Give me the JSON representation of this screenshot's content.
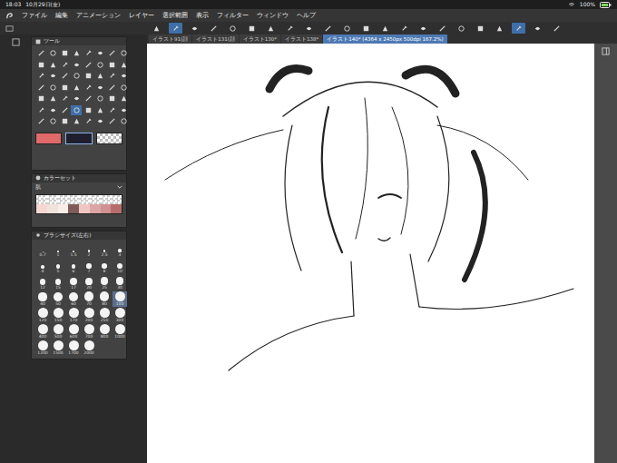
{
  "status_bar": {
    "time": "18:03",
    "date": "10月29日(金)",
    "battery": "100%"
  },
  "menu": [
    "ファイル",
    "編集",
    "アニメーション",
    "レイヤー",
    "選択範囲",
    "表示",
    "フィルター",
    "ウィンドウ",
    "ヘルプ"
  ],
  "commands": [
    {
      "selected": false
    },
    {
      "selected": true
    },
    {
      "selected": false
    },
    {
      "selected": false
    },
    {
      "selected": false
    },
    {
      "selected": false
    },
    {
      "selected": false
    },
    {
      "selected": false
    },
    {
      "selected": false
    },
    {
      "selected": false
    },
    {
      "selected": false
    },
    {
      "selected": false
    },
    {
      "selected": false
    },
    {
      "selected": false
    },
    {
      "selected": false
    },
    {
      "selected": false
    },
    {
      "selected": false
    },
    {
      "selected": false
    },
    {
      "selected": false
    },
    {
      "selected": true
    },
    {
      "selected": false
    },
    {
      "selected": false
    }
  ],
  "tabs": [
    {
      "label": "イラスト91(顔",
      "selected": false
    },
    {
      "label": "イラスト131(顔",
      "selected": false
    },
    {
      "label": "イラスト130*",
      "selected": false
    },
    {
      "label": "イラスト138*",
      "selected": false
    },
    {
      "label": "イラスト140* (4364 x 2450px 500dpi 167.2%)",
      "selected": true
    }
  ],
  "tool_panel": {
    "title": "ツール",
    "tools": [
      {
        "selected": false
      },
      {
        "selected": false
      },
      {
        "selected": false
      },
      {
        "selected": false
      },
      {
        "selected": false
      },
      {
        "selected": false
      },
      {
        "selected": false
      },
      {
        "selected": false
      },
      {
        "selected": false
      },
      {
        "selected": false
      },
      {
        "selected": false
      },
      {
        "selected": false
      },
      {
        "selected": false
      },
      {
        "selected": false
      },
      {
        "selected": false
      },
      {
        "selected": false
      },
      {
        "selected": false
      },
      {
        "selected": false
      },
      {
        "selected": false
      },
      {
        "selected": false
      },
      {
        "selected": false
      },
      {
        "selected": false
      },
      {
        "selected": false
      },
      {
        "selected": false
      },
      {
        "selected": false
      },
      {
        "selected": false
      },
      {
        "selected": false
      },
      {
        "selected": false
      },
      {
        "selected": false
      },
      {
        "selected": false
      },
      {
        "selected": false
      },
      {
        "selected": false
      },
      {
        "selected": false
      },
      {
        "selected": false
      },
      {
        "selected": false
      },
      {
        "selected": false
      },
      {
        "selected": false
      },
      {
        "selected": false
      },
      {
        "selected": false
      },
      {
        "selected": false
      },
      {
        "selected": false
      },
      {
        "selected": false
      },
      {
        "selected": false
      },
      {
        "selected": true
      },
      {
        "selected": false
      },
      {
        "selected": false
      },
      {
        "selected": false
      },
      {
        "selected": false
      },
      {
        "selected": false
      },
      {
        "selected": false
      },
      {
        "selected": false
      },
      {
        "selected": false
      },
      {
        "selected": false
      },
      {
        "selected": false
      },
      {
        "selected": false
      },
      {
        "selected": false
      }
    ],
    "colors": [
      {
        "kind": "solid",
        "color": "#e06a6a",
        "selected": false
      },
      {
        "kind": "solid",
        "color": "#1e1e2c",
        "selected": true
      },
      {
        "kind": "transparent",
        "color": "#ffffff",
        "selected": false
      }
    ]
  },
  "color_set": {
    "title": "カラーセット",
    "set_name": "肌",
    "swatches": [
      {
        "kind": "transparent",
        "color": "#ffffff"
      },
      {
        "kind": "transparent",
        "color": "#ffffff"
      },
      {
        "kind": "transparent",
        "color": "#ffffff"
      },
      {
        "kind": "transparent",
        "color": "#ffffff"
      },
      {
        "kind": "transparent",
        "color": "#ffffff"
      },
      {
        "kind": "transparent",
        "color": "#ffffff"
      },
      {
        "kind": "transparent",
        "color": "#ffffff"
      },
      {
        "kind": "transparent",
        "color": "#ffffff"
      },
      {
        "kind": "solid",
        "color": "#f6d8d2"
      },
      {
        "kind": "solid",
        "color": "#f1e3da"
      },
      {
        "kind": "solid",
        "color": "#fbeee8"
      },
      {
        "kind": "solid",
        "color": "#7e5c58"
      },
      {
        "kind": "solid",
        "color": "#f0c6c2"
      },
      {
        "kind": "solid",
        "color": "#dba5a5"
      },
      {
        "kind": "solid",
        "color": "#cf9191"
      },
      {
        "kind": "solid",
        "color": "#b86d6d"
      }
    ]
  },
  "brush_size": {
    "title": "ブラシサイズ(左右)",
    "sizes": [
      {
        "label": "0.7",
        "selected": false
      },
      {
        "label": "1",
        "selected": false
      },
      {
        "label": "1.5",
        "selected": false
      },
      {
        "label": "2",
        "selected": false
      },
      {
        "label": "2.5",
        "selected": false
      },
      {
        "label": "3",
        "selected": false
      },
      {
        "label": "4",
        "selected": false
      },
      {
        "label": "5",
        "selected": false
      },
      {
        "label": "6",
        "selected": false
      },
      {
        "label": "7",
        "selected": false
      },
      {
        "label": "8",
        "selected": false
      },
      {
        "label": "10",
        "selected": false
      },
      {
        "label": "12",
        "selected": false
      },
      {
        "label": "15",
        "selected": false
      },
      {
        "label": "17",
        "selected": false
      },
      {
        "label": "20",
        "selected": false
      },
      {
        "label": "25",
        "selected": false
      },
      {
        "label": "30",
        "selected": false
      },
      {
        "label": "40",
        "selected": false
      },
      {
        "label": "50",
        "selected": false
      },
      {
        "label": "60",
        "selected": false
      },
      {
        "label": "70",
        "selected": false
      },
      {
        "label": "80",
        "selected": false
      },
      {
        "label": "100",
        "selected": true
      },
      {
        "label": "120",
        "selected": false
      },
      {
        "label": "150",
        "selected": false
      },
      {
        "label": "170",
        "selected": false
      },
      {
        "label": "200",
        "selected": false
      },
      {
        "label": "250",
        "selected": false
      },
      {
        "label": "300",
        "selected": false
      },
      {
        "label": "400",
        "selected": false
      },
      {
        "label": "500",
        "selected": false
      },
      {
        "label": "600",
        "selected": false
      },
      {
        "label": "700",
        "selected": false
      },
      {
        "label": "800",
        "selected": false
      },
      {
        "label": "1000",
        "selected": false
      },
      {
        "label": "1200",
        "selected": false
      },
      {
        "label": "1500",
        "selected": false
      },
      {
        "label": "1700",
        "selected": false
      },
      {
        "label": "2000",
        "selected": false
      }
    ]
  }
}
